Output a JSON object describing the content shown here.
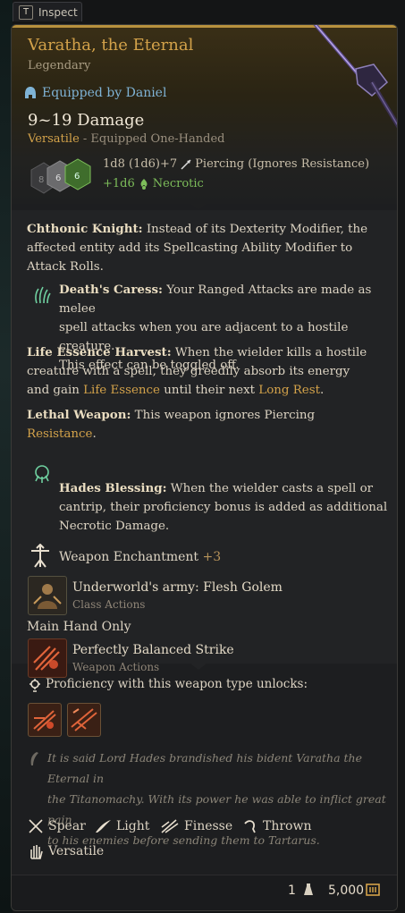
{
  "inspect_tab": {
    "key": "T",
    "label": "Inspect"
  },
  "item": {
    "name": "Varatha, the Eternal",
    "rarity": "Legendary",
    "equipped_by": "Equipped by Daniel",
    "damage": "9~19 Damage",
    "versatile": "Versatile",
    "equip_mode": " - Equipped One-Handed",
    "damage_formula": "1d8 (1d6)+7",
    "damage_type": "Piercing (Ignores Resistance)",
    "bonus_damage": "+1d6",
    "bonus_damage_type": "Necrotic",
    "dice_values": [
      "8",
      "6",
      "6"
    ]
  },
  "passives": [
    {
      "name": "Chthonic Knight:",
      "text_lines": [
        " Instead of its Dexterity Modifier, the",
        "affected entity add its Spellcasting Ability Modifier to",
        "Attack Rolls."
      ]
    },
    {
      "name": "Death's Caress:",
      "text_lines": [
        " Your Ranged Attacks are made as melee",
        "spell attacks when you are adjacent to a hostile creature.",
        "This effect can be toggled off."
      ]
    },
    {
      "name": "Life Essence Harvest:",
      "text_lines": [
        " When the wielder kills a hostile",
        "creature with a spell, they greedily absorb its energy",
        "and gain ",
        "Life Essence",
        " until their next ",
        "Long Rest",
        "."
      ]
    },
    {
      "name": "Lethal Weapon:",
      "text_lines": [
        " This weapon ignores Piercing",
        "Resistance",
        "."
      ]
    },
    {
      "name": "Hades Blessing:",
      "text_lines": [
        " When the wielder casts a spell or",
        "cantrip, their proficiency bonus is added as additional",
        "Necrotic Damage."
      ]
    }
  ],
  "enchantment": {
    "label": "Weapon Enchantment",
    "value": "+3"
  },
  "actions": [
    {
      "name": "Underworld's army: Flesh Golem",
      "category": "Class Actions"
    },
    {
      "name": "Perfectly Balanced Strike",
      "category": "Weapon Actions"
    }
  ],
  "main_hand_only": "Main Hand Only",
  "proficiency": {
    "label": "Proficiency with this weapon type unlocks:"
  },
  "lore_lines": [
    "It is said Lord Hades brandished his bident Varatha the Eternal in",
    "the Titanomachy. With its power he was able to inflict great pain",
    "to his enemies before sending them to Tartarus."
  ],
  "properties": [
    "Spear",
    "Light",
    "Finesse",
    "Thrown",
    "Versatile"
  ],
  "footer": {
    "weight": "1",
    "value": "5,000"
  },
  "colors": {
    "gold": "#d3a24a",
    "necrotic": "#7dbd5a",
    "equipped": "#7fb3d5"
  }
}
